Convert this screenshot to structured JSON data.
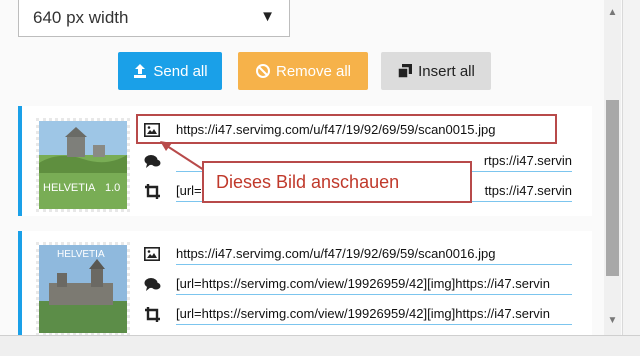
{
  "width_select": {
    "value": "640 px width"
  },
  "buttons": {
    "send_all": "Send all",
    "remove_all": "Remove all",
    "insert_all": "Insert all"
  },
  "cards": [
    {
      "thumb_caption": "HELVETIA",
      "thumb_value": "1.0",
      "image_url": "https://i47.servimg.com/u/f47/19/92/69/59/scan0015.jpg",
      "bbcode_link": "rtps://i47.servin",
      "bbcode_img": "[url=h",
      "bbcode_img_tail": "ttps://i47.servin"
    },
    {
      "thumb_caption": "HELVETIA",
      "image_url": "https://i47.servimg.com/u/f47/19/92/69/59/scan0016.jpg",
      "bbcode_link": "[url=https://servimg.com/view/19926959/42][img]https://i47.servin",
      "bbcode_img": "[url=https://servimg.com/view/19926959/42][img]https://i47.servin"
    }
  ],
  "annotation": {
    "callout_text": "Dieses Bild anschauen",
    "color": "#b84a4a"
  },
  "colors": {
    "accent_blue": "#1aa0e8",
    "remove_orange": "#f6b24a",
    "insert_grey": "#dcdcdc"
  }
}
